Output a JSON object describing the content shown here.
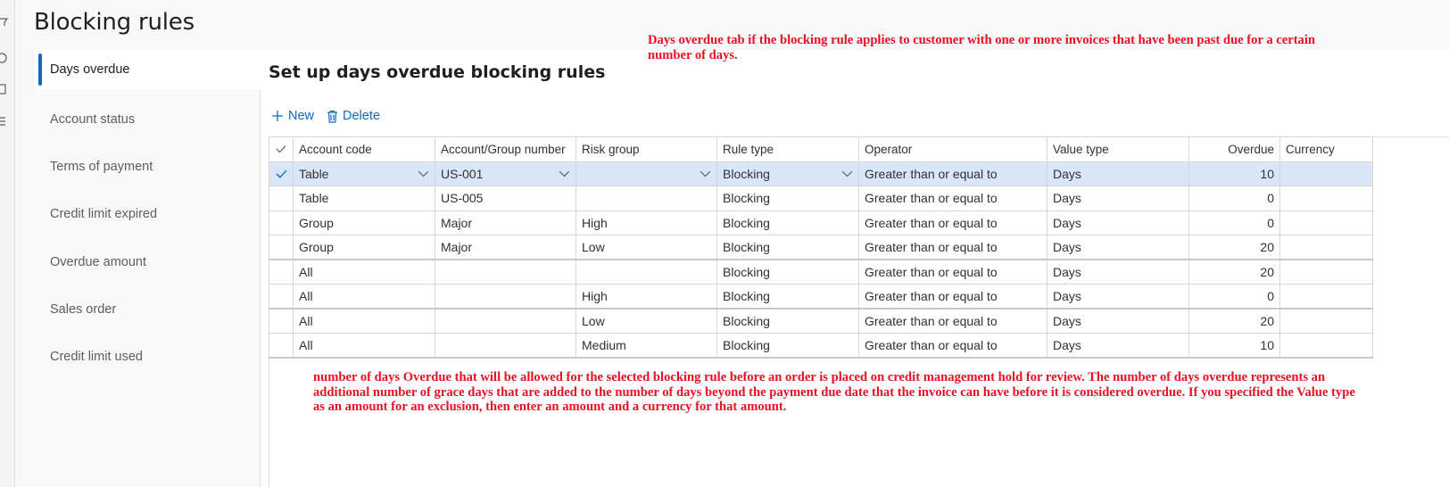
{
  "page": {
    "title": "Blocking rules",
    "section_title": "Set up days overdue blocking rules"
  },
  "nav": {
    "items": [
      {
        "label": "Days overdue",
        "active": true
      },
      {
        "label": "Account status"
      },
      {
        "label": "Terms of payment"
      },
      {
        "label": "Credit limit expired"
      },
      {
        "label": "Overdue amount"
      },
      {
        "label": "Sales order"
      },
      {
        "label": "Credit limit used"
      }
    ]
  },
  "toolbar": {
    "new_label": "New",
    "delete_label": "Delete"
  },
  "grid": {
    "columns": [
      "Account code",
      "Account/Group number",
      "Risk group",
      "Rule type",
      "Operator",
      "Value type",
      "Overdue",
      "Currency"
    ],
    "rows": [
      {
        "account_code": "Table",
        "account_group": "US-001",
        "risk_group": "",
        "rule_type": "Blocking",
        "operator": "Greater than or equal to",
        "value_type": "Days",
        "overdue": "10",
        "currency": "",
        "selected": true
      },
      {
        "account_code": "Table",
        "account_group": "US-005",
        "risk_group": "",
        "rule_type": "Blocking",
        "operator": "Greater than or equal to",
        "value_type": "Days",
        "overdue": "0",
        "currency": ""
      },
      {
        "account_code": "Group",
        "account_group": "Major",
        "risk_group": "High",
        "rule_type": "Blocking",
        "operator": "Greater than or equal to",
        "value_type": "Days",
        "overdue": "0",
        "currency": ""
      },
      {
        "account_code": "Group",
        "account_group": "Major",
        "risk_group": "Low",
        "rule_type": "Blocking",
        "operator": "Greater than or equal to",
        "value_type": "Days",
        "overdue": "20",
        "currency": ""
      },
      {
        "account_code": "All",
        "account_group": "",
        "risk_group": "",
        "rule_type": "Blocking",
        "operator": "Greater than or equal to",
        "value_type": "Days",
        "overdue": "20",
        "currency": ""
      },
      {
        "account_code": "All",
        "account_group": "",
        "risk_group": "High",
        "rule_type": "Blocking",
        "operator": "Greater than or equal to",
        "value_type": "Days",
        "overdue": "0",
        "currency": ""
      },
      {
        "account_code": "All",
        "account_group": "",
        "risk_group": "Low",
        "rule_type": "Blocking",
        "operator": "Greater than or equal to",
        "value_type": "Days",
        "overdue": "20",
        "currency": ""
      },
      {
        "account_code": "All",
        "account_group": "",
        "risk_group": "Medium",
        "rule_type": "Blocking",
        "operator": "Greater than or equal to",
        "value_type": "Days",
        "overdue": "10",
        "currency": ""
      }
    ]
  },
  "annotations": {
    "top": "Days overdue tab if the blocking rule applies to customer with one or more invoices that have been past due for a certain number of days.",
    "bottom": "number of days Overdue that will be allowed for the selected blocking rule before an order is placed on credit management hold for review. The number of days overdue represents an additional number of grace days that are added to the number of days beyond the payment due date that the invoice can have before it is considered overdue. If you specified the Value type as an amount for an exclusion, then enter an amount and a currency for that amount."
  },
  "colors": {
    "accent": "#0f6cbd",
    "selected_row": "#d9e6f8",
    "annotation": "#e81123"
  },
  "icons": {
    "new": "plus-icon",
    "delete": "trash-icon",
    "dropdown": "chevron-down-icon",
    "select": "checkmark-icon"
  }
}
